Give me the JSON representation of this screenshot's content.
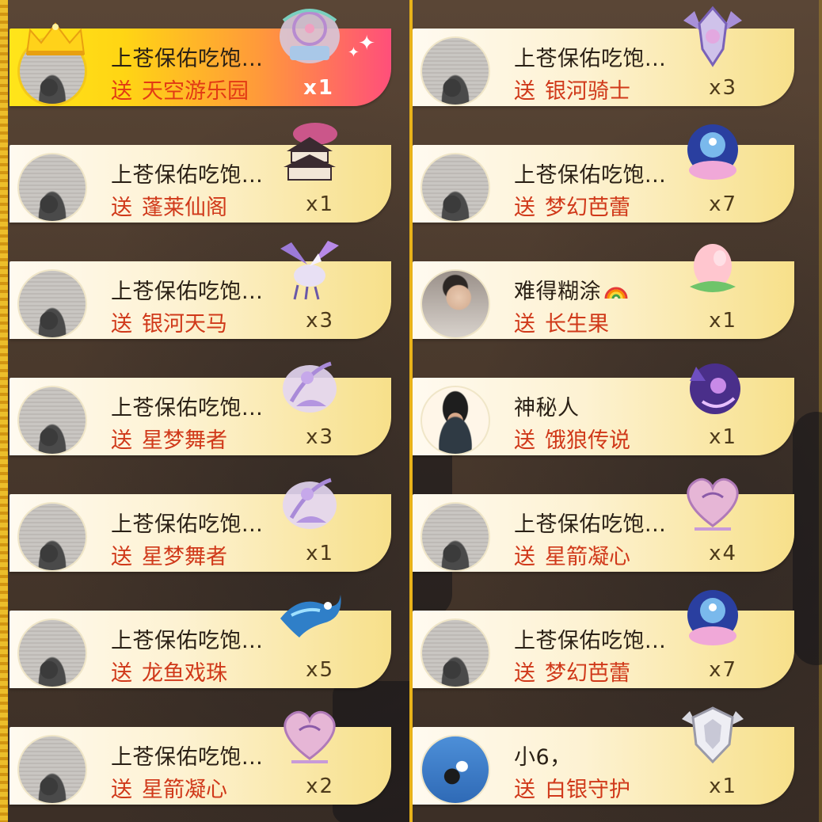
{
  "columns": [
    {
      "rows": [
        {
          "sender": "上苍保佑吃饱...",
          "send_word": "送",
          "gift": "天空游乐园",
          "count": "x1",
          "icon": "amusement-park-gift-icon",
          "highlight": true,
          "crown": true
        },
        {
          "sender": "上苍保佑吃饱...",
          "send_word": "送",
          "gift": "蓬莱仙阁",
          "count": "x1",
          "icon": "pavilion-gift-icon",
          "highlight": false,
          "crown": false
        },
        {
          "sender": "上苍保佑吃饱...",
          "send_word": "送",
          "gift": "银河天马",
          "count": "x3",
          "icon": "pegasus-gift-icon",
          "highlight": false,
          "crown": false
        },
        {
          "sender": "上苍保佑吃饱...",
          "send_word": "送",
          "gift": "星梦舞者",
          "count": "x3",
          "icon": "dancer-gift-icon",
          "highlight": false,
          "crown": false
        },
        {
          "sender": "上苍保佑吃饱...",
          "send_word": "送",
          "gift": "星梦舞者",
          "count": "x1",
          "icon": "dancer-gift-icon",
          "highlight": false,
          "crown": false
        },
        {
          "sender": "上苍保佑吃饱...",
          "send_word": "送",
          "gift": "龙鱼戏珠",
          "count": "x5",
          "icon": "dragon-fish-gift-icon",
          "highlight": false,
          "crown": false
        },
        {
          "sender": "上苍保佑吃饱...",
          "send_word": "送",
          "gift": "星箭凝心",
          "count": "x2",
          "icon": "heart-arrow-gift-icon",
          "highlight": false,
          "crown": false
        }
      ]
    },
    {
      "rows": [
        {
          "sender": "上苍保佑吃饱...",
          "send_word": "送",
          "gift": "银河骑士",
          "count": "x3",
          "icon": "knight-gift-icon"
        },
        {
          "sender": "上苍保佑吃饱...",
          "send_word": "送",
          "gift": "梦幻芭蕾",
          "count": "x7",
          "icon": "ballet-gift-icon"
        },
        {
          "sender": "难得糊涂",
          "send_word": "送",
          "gift": "长生果",
          "count": "x1",
          "icon": "peach-gift-icon",
          "rainbow": true,
          "avatar": "sleep"
        },
        {
          "sender": "神秘人",
          "send_word": "送",
          "gift": "饿狼传说",
          "count": "x1",
          "icon": "wolf-gift-icon",
          "avatar": "spy"
        },
        {
          "sender": "上苍保佑吃饱...",
          "send_word": "送",
          "gift": "星箭凝心",
          "count": "x4",
          "icon": "heart-arrow-gift-icon"
        },
        {
          "sender": "上苍保佑吃饱...",
          "send_word": "送",
          "gift": "梦幻芭蕾",
          "count": "x7",
          "icon": "ballet-gift-icon"
        },
        {
          "sender": "小6，",
          "send_word": "送",
          "gift": "白银守护",
          "count": "x1",
          "icon": "silver-shield-gift-icon",
          "avatar": "sky"
        }
      ]
    }
  ],
  "colors": {
    "divider": "#e8b21a",
    "gift_text": "#d0391a",
    "row_gradient_end": "#f7e08a",
    "highlight_start": "#ffe51a",
    "highlight_end": "#ff4f7a"
  }
}
